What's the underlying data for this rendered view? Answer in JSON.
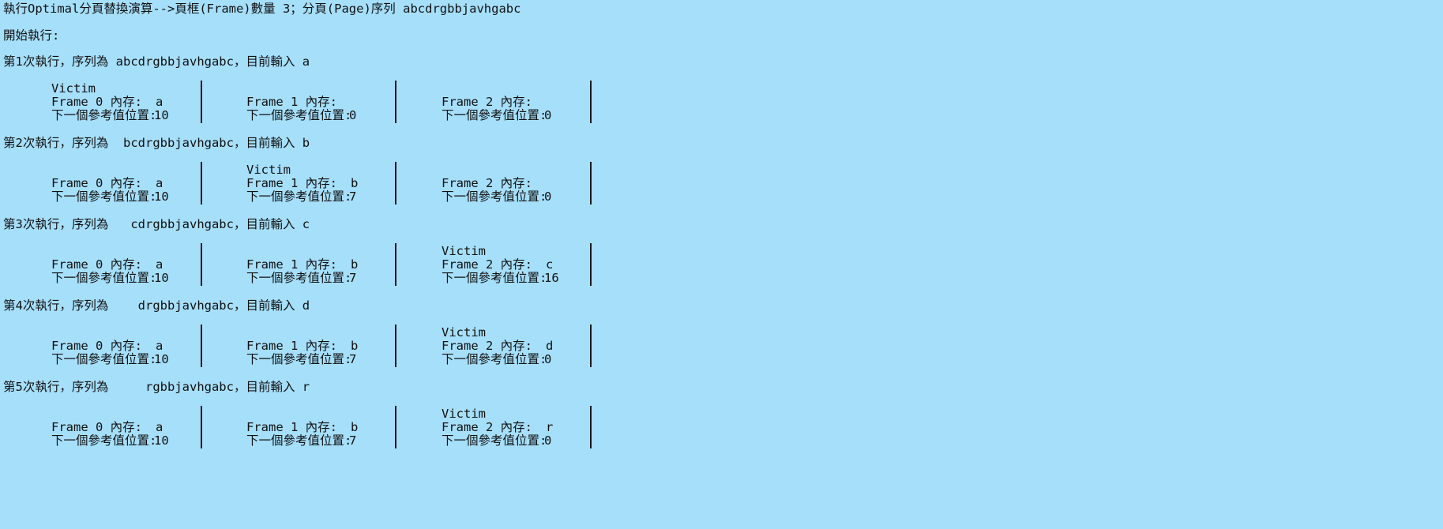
{
  "header": {
    "title": "執行Optimal分頁替換演算-->頁框(Frame)數量 3；分頁(Page)序列 abcdrgbbjavhgabc",
    "start": "開始執行:"
  },
  "labels": {
    "victim": "Victim",
    "frame_mem": [
      "Frame 0 內存:",
      "Frame 1 內存:",
      "Frame 2 內存:"
    ],
    "next_ref": "下一個參考值位置:"
  },
  "steps": [
    {
      "heading": "第1次執行，序列為 abcdrgbbjavhgabc，目前輸入 a",
      "victim_frame": 0,
      "contents": [
        "a",
        "",
        ""
      ],
      "next_ref": [
        "10",
        "0",
        "0"
      ]
    },
    {
      "heading": "第2次執行，序列為  bcdrgbbjavhgabc，目前輸入 b",
      "victim_frame": 1,
      "contents": [
        "a",
        "b",
        ""
      ],
      "next_ref": [
        "10",
        "7",
        "0"
      ]
    },
    {
      "heading": "第3次執行，序列為   cdrgbbjavhgabc，目前輸入 c",
      "victim_frame": 2,
      "contents": [
        "a",
        "b",
        "c"
      ],
      "next_ref": [
        "10",
        "7",
        "16"
      ]
    },
    {
      "heading": "第4次執行，序列為    drgbbjavhgabc，目前輸入 d",
      "victim_frame": 2,
      "contents": [
        "a",
        "b",
        "d"
      ],
      "next_ref": [
        "10",
        "7",
        "0"
      ]
    },
    {
      "heading": "第5次執行，序列為     rgbbjavhgabc，目前輸入 r",
      "victim_frame": 2,
      "contents": [
        "a",
        "b",
        "r"
      ],
      "next_ref": [
        "10",
        "7",
        "0"
      ]
    }
  ]
}
